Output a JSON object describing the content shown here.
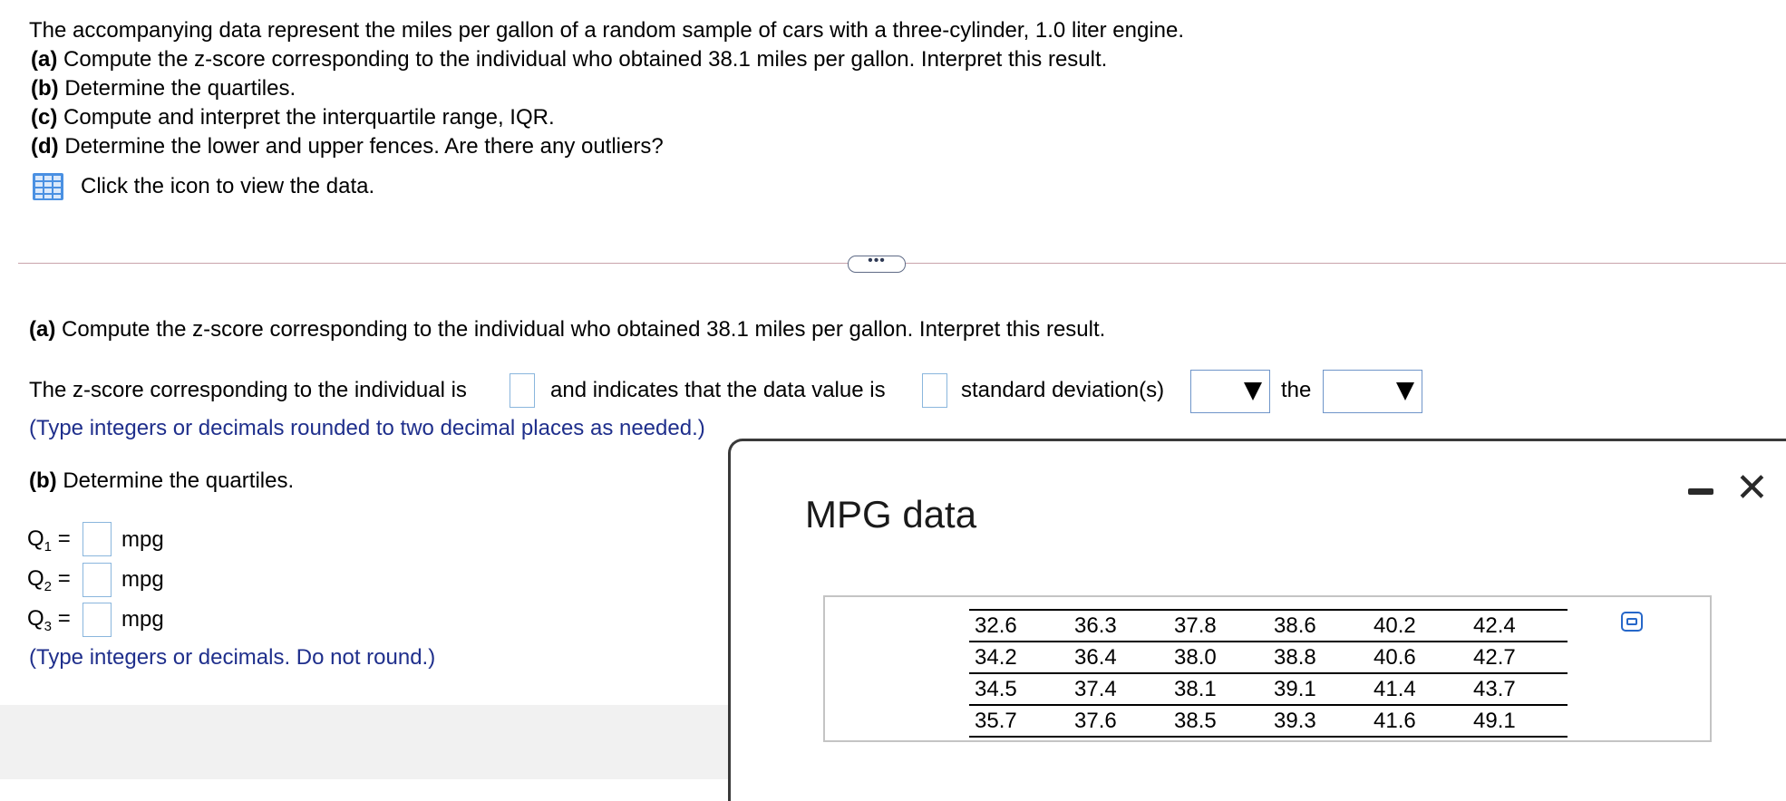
{
  "problem": {
    "intro": "The accompanying data represent the miles per gallon of a random sample of cars with a three-cylinder, 1.0 liter engine.",
    "parts": [
      {
        "label": "(a)",
        "text": "Compute the z-score corresponding to the individual who obtained 38.1 miles per gallon. Interpret this result."
      },
      {
        "label": "(b)",
        "text": "Determine the quartiles."
      },
      {
        "label": "(c)",
        "text": "Compute and interpret the interquartile range, IQR."
      },
      {
        "label": "(d)",
        "text": "Determine the lower and upper fences. Are there any outliers?"
      }
    ],
    "data_link": "Click the icon to view the data."
  },
  "divider": {
    "button_label": "•••"
  },
  "part_a": {
    "label": "(a)",
    "heading": "Compute the z-score corresponding to the individual who obtained 38.1 miles per gallon. Interpret this result.",
    "sentence_1": "The z-score corresponding to the individual is",
    "sentence_2": "and indicates that the data value is",
    "sentence_3": "standard deviation(s)",
    "sentence_4": "the",
    "hint": "(Type integers or decimals rounded to two decimal places as needed.)"
  },
  "part_b": {
    "label": "(b)",
    "heading": "Determine the quartiles.",
    "q1_label": "Q",
    "q1_sub": "1",
    "q2_label": "Q",
    "q2_sub": "2",
    "q3_label": "Q",
    "q3_sub": "3",
    "equals": "=",
    "unit": "mpg",
    "hint": "(Type integers or decimals. Do not round.)"
  },
  "popup": {
    "title": "MPG data",
    "rows": [
      [
        "32.6",
        "36.3",
        "37.8",
        "38.6",
        "40.2",
        "42.4"
      ],
      [
        "34.2",
        "36.4",
        "38.0",
        "38.8",
        "40.6",
        "42.7"
      ],
      [
        "34.5",
        "37.4",
        "38.1",
        "39.1",
        "41.4",
        "43.7"
      ],
      [
        "35.7",
        "37.6",
        "38.5",
        "39.3",
        "41.6",
        "49.1"
      ]
    ]
  },
  "colors": {
    "hint_blue": "#1f2f8c",
    "box_border": "#8ab6dd",
    "icon_blue": "#2667c9"
  }
}
